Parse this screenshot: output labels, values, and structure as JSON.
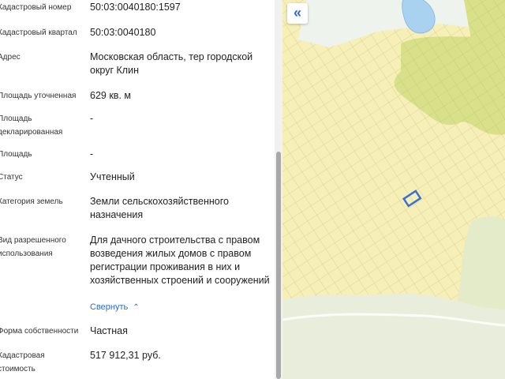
{
  "properties": [
    {
      "label": "Кадастровый номер",
      "value": "50:03:0040180:1597"
    },
    {
      "label": "Кадастровый квартал",
      "value": "50:03:0040180"
    },
    {
      "label": "Адрес",
      "value": "Московская область, тер городской округ Клин"
    },
    {
      "label": "Площадь уточненная",
      "value": "629 кв. м"
    },
    {
      "label": "Площадь декларированная",
      "value": "-"
    },
    {
      "label": "Площадь",
      "value": "-"
    },
    {
      "label": "Статус",
      "value": "Учтенный"
    },
    {
      "label": "Категория земель",
      "value": "Земли сельскохозяйственного назначения"
    },
    {
      "label": "Вид разрешенного использования",
      "value": "Для дачного строительства с правом возведения жилых домов с правом регистрации проживания в них и хозяйственных строений и сооружений"
    },
    {
      "label": "Форма собственности",
      "value": "Частная"
    },
    {
      "label": "Кадастровая стоимость",
      "value": "517 912,31 руб."
    }
  ],
  "collapse_link": {
    "label": "Свернуть",
    "icon": "chevron-up-icon"
  },
  "map": {
    "collapse_button": {
      "label": "«",
      "icon": "double-chevron-left-icon"
    },
    "colors": {
      "parcel_fill": "#f6efb8",
      "forest": "#d9e08a",
      "water": "#a8d2f0",
      "selected_outline": "#3a6fd8",
      "grid": "#d6c98a"
    }
  }
}
